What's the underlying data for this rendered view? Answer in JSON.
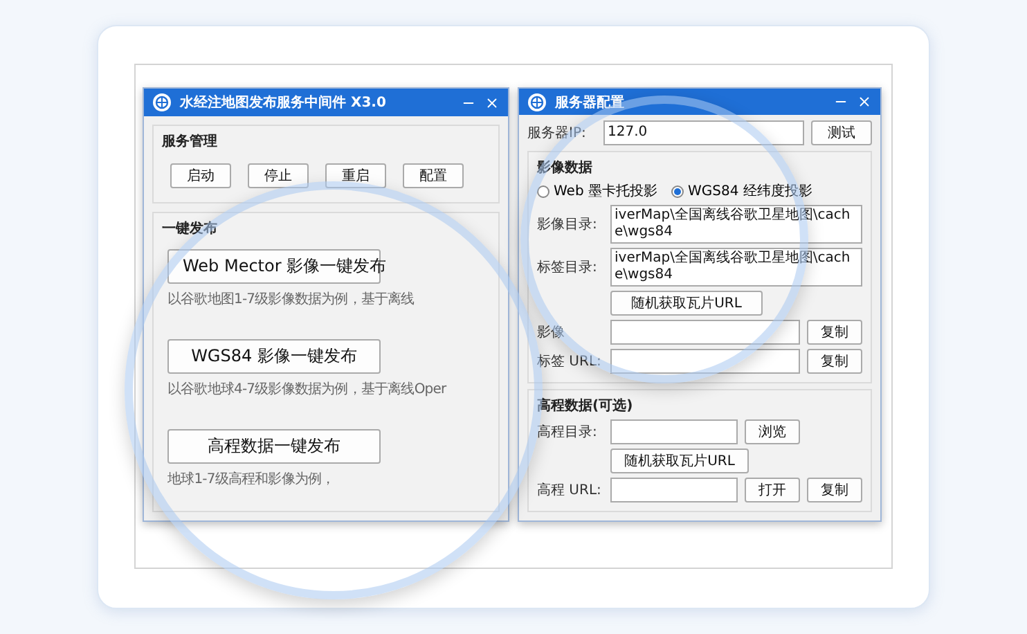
{
  "left_window": {
    "title": "水经注地图发布服务中间件 X3.0",
    "service_group": {
      "title": "服务管理",
      "buttons": [
        "启动",
        "停止",
        "重启",
        "配置"
      ]
    },
    "publish_group": {
      "title": "一键发布",
      "items": [
        {
          "button": "Web Mector 影像一键发布",
          "description": "以谷歌地图1-7级影像数据为例，基于离线"
        },
        {
          "button": "WGS84 影像一键发布",
          "description": "以谷歌地球4-7级影像数据为例，基于离线Oper"
        },
        {
          "button": "高程数据一键发布",
          "description": "地球1-7级高程和影像为例，"
        }
      ]
    }
  },
  "right_window": {
    "title": "服务器配置",
    "server": {
      "label": "服务器IP:",
      "value": "127.0",
      "button": "测试"
    },
    "imagery": {
      "title": "影像数据",
      "projections": [
        {
          "label": "Web 墨卡托投影",
          "selected": false
        },
        {
          "label": "WGS84 经纬度投影",
          "selected": true
        }
      ],
      "dirs": [
        {
          "label": "影像目录:",
          "value": "iverMap\\全国离线谷歌卫星地图\\cache\\wgs84"
        },
        {
          "label": "标签目录:",
          "value": "iverMap\\全国离线谷歌卫星地图\\cache\\wgs84"
        }
      ],
      "random_button": "随机获取瓦片URL",
      "urls": [
        {
          "label": "影像",
          "button": "复制"
        },
        {
          "label": "标签 URL:",
          "button": "复制"
        }
      ]
    },
    "elevation": {
      "title": "高程数据(可选)",
      "dir_label": "高程目录:",
      "browse_button": "浏览",
      "random_button": "随机获取瓦片URL",
      "url_label": "高程 URL:",
      "url_buttons": [
        "打开",
        "复制"
      ]
    }
  }
}
